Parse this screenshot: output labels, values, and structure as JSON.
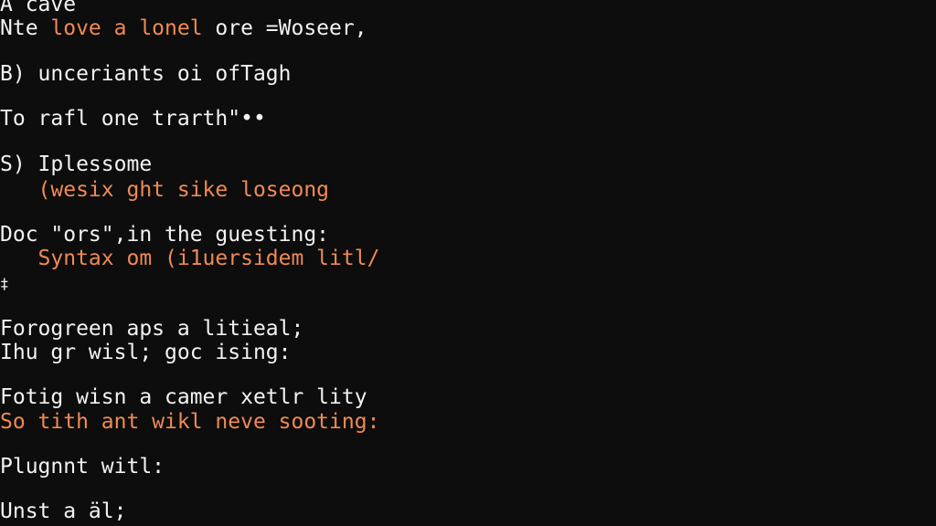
{
  "colors": {
    "background": "#0d0d0d",
    "text": "#f2f2f2",
    "accent": "#f08a55"
  },
  "lines": [
    {
      "segments": [
        "A cave"
      ]
    },
    {
      "segments": [
        "Nte ",
        "love a lonel",
        " ore =Woseer,"
      ]
    },
    {
      "segments": [
        "B) unceriants oi ofTagh"
      ]
    },
    {
      "segments": [
        "To rafl one trarth\"••"
      ]
    },
    {
      "segments": [
        "S) Iplessome"
      ]
    },
    {
      "segments": [
        "   (wesix ght sike loseong"
      ]
    },
    {
      "segments": [
        "Doc \"ors\",in the guesting:"
      ]
    },
    {
      "segments": [
        "   Syntax om (i1uersidem litl/"
      ]
    },
    {
      "segments": [
        "‡"
      ]
    },
    {
      "segments": [
        "Forogreen aps a litieal;"
      ]
    },
    {
      "segments": [
        "Ihu gr wisl; goc ising:"
      ]
    },
    {
      "segments": [
        "Fotig wisn a camer xetlr lity"
      ]
    },
    {
      "segments": [
        "So tith ant wikl neve sooting:"
      ]
    },
    {
      "segments": [
        "Plugnnt witl:"
      ]
    },
    {
      "segments": [
        "Unst a äl;"
      ]
    }
  ]
}
